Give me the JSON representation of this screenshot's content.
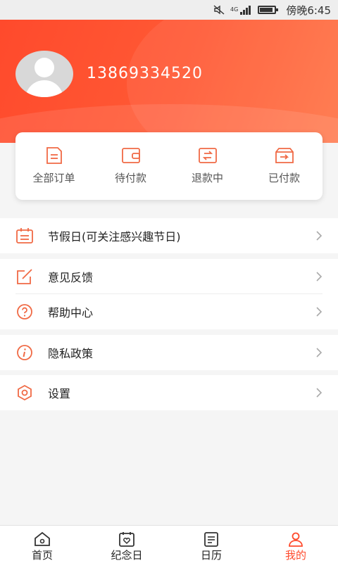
{
  "status_bar": {
    "time": "傍晚6:45",
    "network": "4G"
  },
  "profile": {
    "phone": "13869334520"
  },
  "orders": [
    {
      "label": "全部订单",
      "icon": "document-icon"
    },
    {
      "label": "待付款",
      "icon": "wallet-icon"
    },
    {
      "label": "退款中",
      "icon": "refund-icon"
    },
    {
      "label": "已付款",
      "icon": "paid-box-icon"
    }
  ],
  "menu": {
    "holidays": "节假日(可关注感兴趣节日)",
    "feedback": "意见反馈",
    "help": "帮助中心",
    "privacy": "隐私政策",
    "settings": "设置"
  },
  "tabs": [
    {
      "label": "首页",
      "icon": "home-icon",
      "active": false
    },
    {
      "label": "纪念日",
      "icon": "heart-calendar-icon",
      "active": false
    },
    {
      "label": "日历",
      "icon": "calendar-list-icon",
      "active": false
    },
    {
      "label": "我的",
      "icon": "person-icon",
      "active": true
    }
  ],
  "colors": {
    "accent": "#ff4a2c",
    "icon_orange": "#f06a45",
    "background": "#f5f5f5"
  }
}
